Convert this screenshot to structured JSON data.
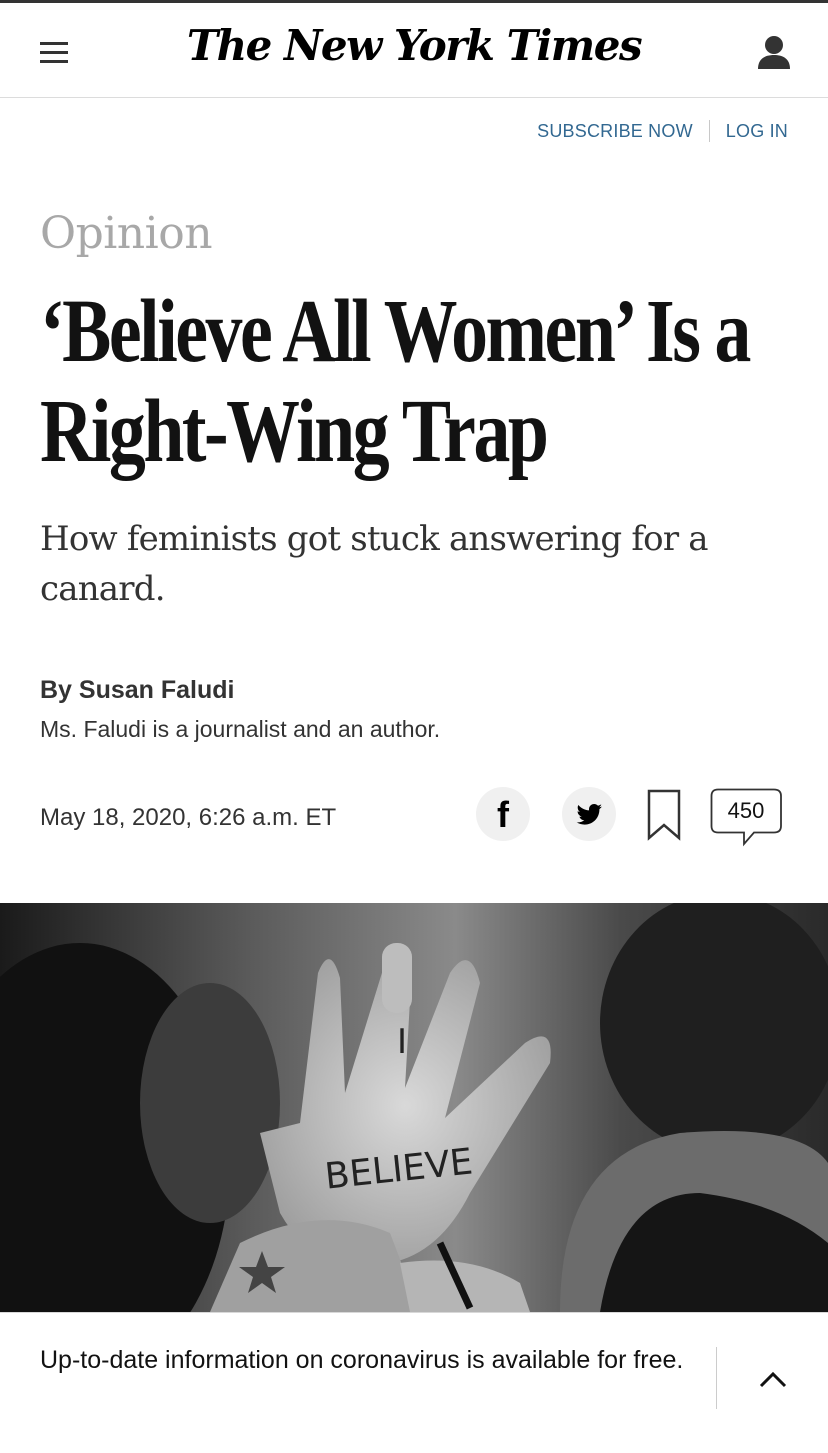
{
  "header": {
    "logo_text": "The New York Times",
    "subscribe_label": "SUBSCRIBE NOW",
    "login_label": "LOG IN"
  },
  "article": {
    "section": "Opinion",
    "headline_line1": "‘Believe All Women’ Is a",
    "headline_line2": "Right-Wing Trap",
    "dek": "How feminists got stuck answering for a canard.",
    "byline": "By Susan Faludi",
    "author_bio": "Ms. Faludi is a journalist and an author.",
    "dateline": "May 18, 2020, 6:26 a.m. ET"
  },
  "share": {
    "facebook_icon": "facebook-icon",
    "twitter_icon": "twitter-icon",
    "bookmark_icon": "bookmark-icon",
    "comment_count": "450"
  },
  "photo": {
    "hand_text": "BELIEVE",
    "finger_text": "I"
  },
  "banner": {
    "text": "Up-to-date information on coronavirus is available for free."
  },
  "colors": {
    "link_blue": "#326891",
    "section_gray": "#a8a8a8",
    "text_dark": "#121212"
  }
}
